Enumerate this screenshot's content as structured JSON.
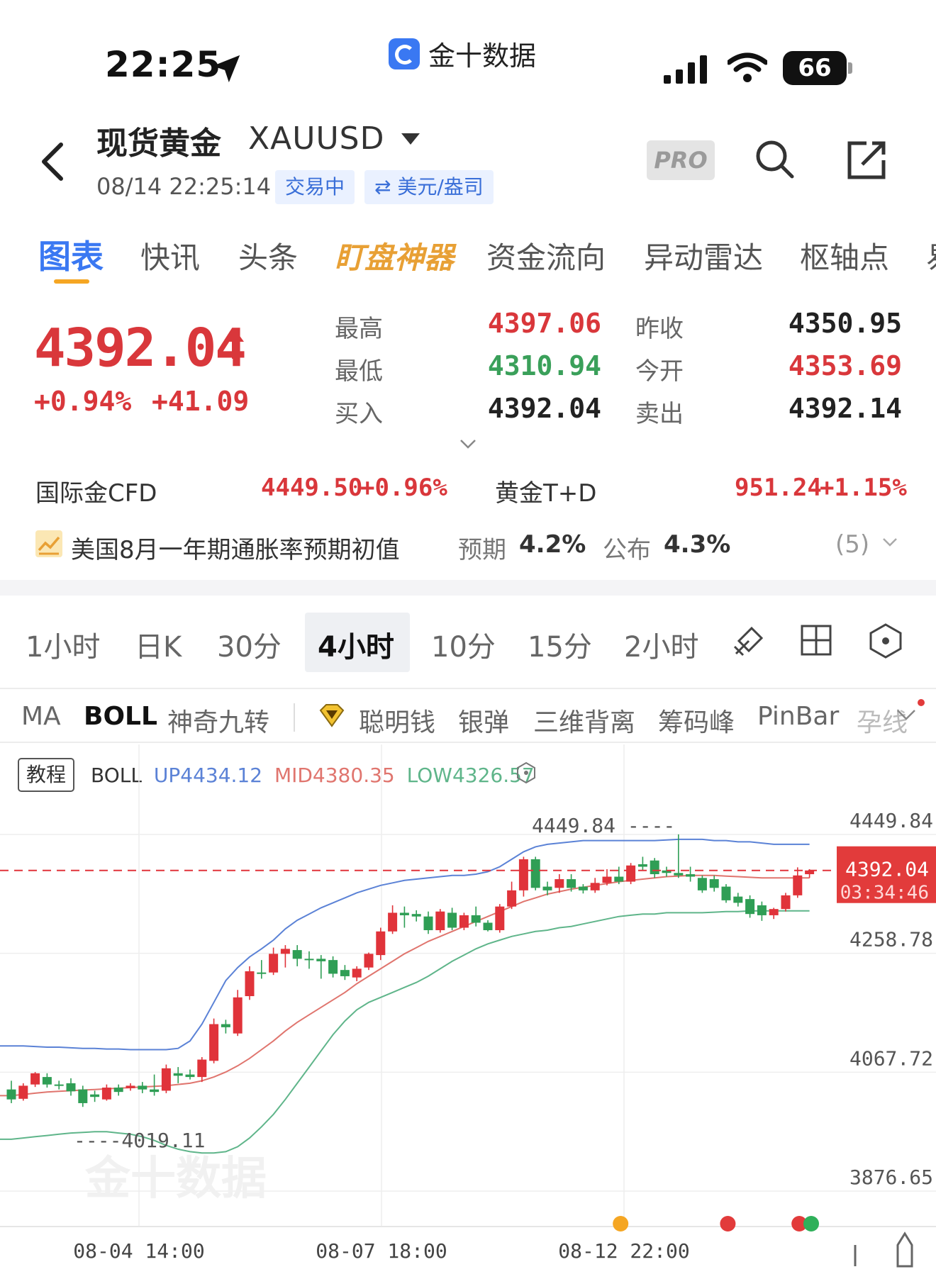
{
  "status_bar": {
    "time": "22:25",
    "app_name": "金十数据",
    "battery": "66"
  },
  "header": {
    "title": "现货黄金",
    "symbol": "XAUUSD",
    "datetime": "08/14 22:25:14",
    "trading_status": "交易中",
    "currency_toggle": "⇄ 美元/盎司",
    "pro_label": "PRO"
  },
  "tabs": [
    {
      "label": "图表"
    },
    {
      "label": "快讯"
    },
    {
      "label": "头条"
    },
    {
      "label": "盯盘神器"
    },
    {
      "label": "资金流向"
    },
    {
      "label": "异动雷达"
    },
    {
      "label": "枢轴点"
    },
    {
      "label": "易"
    }
  ],
  "quote": {
    "price": "4392.04",
    "change_pct": "+0.94%",
    "change_abs": "+41.09",
    "high_label": "最高",
    "high": "4397.06",
    "low_label": "最低",
    "low": "4310.94",
    "bid_label": "买入",
    "bid": "4392.04",
    "prev_close_label": "昨收",
    "prev_close": "4350.95",
    "open_label": "今开",
    "open": "4353.69",
    "ask_label": "卖出",
    "ask": "4392.14",
    "colors": {
      "up": "#d9373b",
      "down": "#3aa05a"
    }
  },
  "tickers": [
    {
      "label": "国际金CFD",
      "value": "4449.50",
      "change": "+0.96%"
    },
    {
      "label": "黄金T+D",
      "value": "951.24",
      "change": "+1.15%"
    }
  ],
  "economic": {
    "title": "美国8月一年期通胀率预期初值",
    "expected_label": "预期",
    "expected": "4.2%",
    "actual_label": "公布",
    "actual": "4.3%",
    "count": "(5)"
  },
  "periods": [
    {
      "label": "1小时"
    },
    {
      "label": "日K"
    },
    {
      "label": "30分"
    },
    {
      "label": "4小时",
      "selected": true
    },
    {
      "label": "10分"
    },
    {
      "label": "15分"
    },
    {
      "label": "2小时"
    }
  ],
  "indicators": [
    {
      "label": "MA"
    },
    {
      "label": "BOLL",
      "selected": true
    },
    {
      "label": "神奇九转"
    },
    {
      "label": "聪明钱"
    },
    {
      "label": "银弹"
    },
    {
      "label": "三维背离"
    },
    {
      "label": "筹码峰"
    },
    {
      "label": "PinBar"
    },
    {
      "label": "孕线"
    }
  ],
  "chart_legend": {
    "tutorial": "教程",
    "name": "BOLL",
    "up": "UP4434.12",
    "mid": "MID4380.35",
    "low": "LOW4326.57"
  },
  "chart_data": {
    "type": "candlestick",
    "indicator": "BOLL",
    "ylim": [
      3800,
      4500
    ],
    "y_ticks": [
      4449.84,
      4258.78,
      4067.72,
      3876.65
    ],
    "x_ticks": [
      "08-04 14:00",
      "08-07 18:00",
      "08-12 22:00"
    ],
    "current_price": 4392.04,
    "countdown": "03:34:46",
    "max_annotation": "4449.84",
    "min_annotation": "4019.11",
    "colors": {
      "up": "#e0333a",
      "down": "#2f9e55",
      "upper": "#5b82d6",
      "mid": "#e0756e",
      "lower": "#5fb58a"
    },
    "candles": [
      {
        "o": 4040,
        "h": 4054,
        "c": 4024,
        "l": 4018
      },
      {
        "o": 4025,
        "h": 4050,
        "c": 4046,
        "l": 4022
      },
      {
        "o": 4048,
        "h": 4068,
        "c": 4066,
        "l": 4044
      },
      {
        "o": 4060,
        "h": 4066,
        "c": 4048,
        "l": 4043
      },
      {
        "o": 4048,
        "h": 4054,
        "c": 4046,
        "l": 4040
      },
      {
        "o": 4050,
        "h": 4058,
        "c": 4037,
        "l": 4030
      },
      {
        "o": 4040,
        "h": 4046,
        "c": 4018,
        "l": 4012
      },
      {
        "o": 4032,
        "h": 4038,
        "c": 4028,
        "l": 4020
      },
      {
        "o": 4024,
        "h": 4048,
        "c": 4043,
        "l": 4022
      },
      {
        "o": 4043,
        "h": 4048,
        "c": 4036,
        "l": 4030
      },
      {
        "o": 4042,
        "h": 4050,
        "c": 4046,
        "l": 4038
      },
      {
        "o": 4046,
        "h": 4052,
        "c": 4040,
        "l": 4034
      },
      {
        "o": 4040,
        "h": 4064,
        "c": 4036,
        "l": 4030
      },
      {
        "o": 4038,
        "h": 4080,
        "c": 4074,
        "l": 4034
      },
      {
        "o": 4066,
        "h": 4076,
        "c": 4062,
        "l": 4050
      },
      {
        "o": 4064,
        "h": 4072,
        "c": 4060,
        "l": 4056
      },
      {
        "o": 4060,
        "h": 4092,
        "c": 4088,
        "l": 4052
      },
      {
        "o": 4086,
        "h": 4154,
        "c": 4145,
        "l": 4082
      },
      {
        "o": 4145,
        "h": 4152,
        "c": 4140,
        "l": 4130
      },
      {
        "o": 4130,
        "h": 4200,
        "c": 4188,
        "l": 4126
      },
      {
        "o": 4190,
        "h": 4238,
        "c": 4230,
        "l": 4184
      },
      {
        "o": 4228,
        "h": 4248,
        "c": 4226,
        "l": 4218
      },
      {
        "o": 4228,
        "h": 4268,
        "c": 4258,
        "l": 4224
      },
      {
        "o": 4258,
        "h": 4272,
        "c": 4266,
        "l": 4236
      },
      {
        "o": 4264,
        "h": 4272,
        "c": 4250,
        "l": 4238
      },
      {
        "o": 4250,
        "h": 4262,
        "c": 4248,
        "l": 4234
      },
      {
        "o": 4250,
        "h": 4256,
        "c": 4246,
        "l": 4218
      },
      {
        "o": 4248,
        "h": 4254,
        "c": 4226,
        "l": 4220
      },
      {
        "o": 4232,
        "h": 4240,
        "c": 4222,
        "l": 4216
      },
      {
        "o": 4220,
        "h": 4238,
        "c": 4234,
        "l": 4214
      },
      {
        "o": 4236,
        "h": 4260,
        "c": 4258,
        "l": 4232
      },
      {
        "o": 4256,
        "h": 4300,
        "c": 4294,
        "l": 4248
      },
      {
        "o": 4294,
        "h": 4336,
        "c": 4324,
        "l": 4290
      },
      {
        "o": 4324,
        "h": 4334,
        "c": 4320,
        "l": 4300
      },
      {
        "o": 4322,
        "h": 4328,
        "c": 4318,
        "l": 4310
      },
      {
        "o": 4318,
        "h": 4326,
        "c": 4296,
        "l": 4290
      },
      {
        "o": 4296,
        "h": 4330,
        "c": 4326,
        "l": 4292
      },
      {
        "o": 4324,
        "h": 4332,
        "c": 4300,
        "l": 4296
      },
      {
        "o": 4300,
        "h": 4324,
        "c": 4320,
        "l": 4296
      },
      {
        "o": 4320,
        "h": 4334,
        "c": 4308,
        "l": 4302
      },
      {
        "o": 4308,
        "h": 4312,
        "c": 4296,
        "l": 4294
      },
      {
        "o": 4296,
        "h": 4338,
        "c": 4334,
        "l": 4292
      },
      {
        "o": 4334,
        "h": 4374,
        "c": 4360,
        "l": 4330
      },
      {
        "o": 4360,
        "h": 4414,
        "c": 4410,
        "l": 4350
      },
      {
        "o": 4410,
        "h": 4414,
        "c": 4364,
        "l": 4360
      },
      {
        "o": 4366,
        "h": 4374,
        "c": 4360,
        "l": 4352
      },
      {
        "o": 4364,
        "h": 4386,
        "c": 4378,
        "l": 4356
      },
      {
        "o": 4378,
        "h": 4386,
        "c": 4364,
        "l": 4358
      },
      {
        "o": 4366,
        "h": 4370,
        "c": 4360,
        "l": 4355
      },
      {
        "o": 4360,
        "h": 4380,
        "c": 4372,
        "l": 4356
      },
      {
        "o": 4372,
        "h": 4394,
        "c": 4382,
        "l": 4368
      },
      {
        "o": 4382,
        "h": 4398,
        "c": 4374,
        "l": 4370
      },
      {
        "o": 4374,
        "h": 4404,
        "c": 4400,
        "l": 4370
      },
      {
        "o": 4402,
        "h": 4414,
        "c": 4398,
        "l": 4392
      },
      {
        "o": 4408,
        "h": 4412,
        "c": 4386,
        "l": 4380
      },
      {
        "o": 4392,
        "h": 4398,
        "c": 4388,
        "l": 4382
      },
      {
        "o": 4388,
        "h": 4450,
        "c": 4384,
        "l": 4380
      },
      {
        "o": 4386,
        "h": 4398,
        "c": 4382,
        "l": 4374
      },
      {
        "o": 4380,
        "h": 4384,
        "c": 4360,
        "l": 4356
      },
      {
        "o": 4378,
        "h": 4384,
        "c": 4364,
        "l": 4358
      },
      {
        "o": 4366,
        "h": 4370,
        "c": 4344,
        "l": 4340
      },
      {
        "o": 4350,
        "h": 4356,
        "c": 4340,
        "l": 4334
      },
      {
        "o": 4346,
        "h": 4352,
        "c": 4322,
        "l": 4316
      },
      {
        "o": 4336,
        "h": 4342,
        "c": 4320,
        "l": 4311
      },
      {
        "o": 4320,
        "h": 4332,
        "c": 4330,
        "l": 4314
      },
      {
        "o": 4330,
        "h": 4356,
        "c": 4352,
        "l": 4326
      },
      {
        "o": 4352,
        "h": 4397,
        "c": 4384,
        "l": 4348
      },
      {
        "o": 4386,
        "h": 4394,
        "c": 4392,
        "l": 4380
      }
    ],
    "upper_band": [
      4110,
      4110,
      4109,
      4108,
      4108,
      4107,
      4106,
      4106,
      4105,
      4105,
      4104,
      4104,
      4104,
      4104,
      4106,
      4118,
      4145,
      4180,
      4215,
      4236,
      4253,
      4266,
      4280,
      4298,
      4312,
      4322,
      4332,
      4340,
      4348,
      4356,
      4362,
      4368,
      4372,
      4376,
      4378,
      4380,
      4382,
      4384,
      4384,
      4386,
      4390,
      4398,
      4410,
      4422,
      4430,
      4434,
      4436,
      4438,
      4440,
      4440,
      4440,
      4440,
      4440,
      4440,
      4440,
      4441,
      4442,
      4442,
      4442,
      4440,
      4440,
      4438,
      4438,
      4436,
      4434,
      4434,
      4434,
      4434
    ],
    "mid_band": [
      4030,
      4032,
      4034,
      4036,
      4037,
      4038,
      4039,
      4040,
      4041,
      4042,
      4043,
      4044,
      4045,
      4046,
      4048,
      4050,
      4054,
      4060,
      4068,
      4078,
      4090,
      4104,
      4118,
      4134,
      4148,
      4160,
      4172,
      4184,
      4196,
      4210,
      4222,
      4234,
      4246,
      4258,
      4268,
      4278,
      4286,
      4294,
      4302,
      4310,
      4318,
      4326,
      4334,
      4342,
      4348,
      4354,
      4358,
      4362,
      4365,
      4368,
      4371,
      4374,
      4376,
      4378,
      4380,
      4382,
      4383,
      4384,
      4384,
      4384,
      4383,
      4382,
      4381,
      4380,
      4380,
      4380,
      4380,
      4380
    ],
    "lower_band": [
      3960,
      3962,
      3964,
      3966,
      3968,
      3970,
      3971,
      3972,
      3972,
      3970,
      3968,
      3964,
      3958,
      3950,
      3944,
      3940,
      3938,
      3938,
      3940,
      3948,
      3962,
      3980,
      4000,
      4024,
      4050,
      4076,
      4102,
      4128,
      4150,
      4168,
      4180,
      4188,
      4196,
      4204,
      4212,
      4222,
      4234,
      4246,
      4256,
      4266,
      4274,
      4280,
      4286,
      4290,
      4294,
      4296,
      4300,
      4302,
      4306,
      4310,
      4314,
      4318,
      4320,
      4322,
      4322,
      4324,
      4324,
      4324,
      4324,
      4325,
      4326,
      4326,
      4327,
      4327,
      4327,
      4327,
      4327,
      4327
    ],
    "event_markers": [
      {
        "index": 49,
        "color": "#f5a623"
      },
      {
        "index": 58,
        "color": "#e23b3b"
      },
      {
        "index": 64,
        "color": "#e23b3b"
      },
      {
        "index": 65,
        "color": "#2fb05a"
      }
    ]
  }
}
